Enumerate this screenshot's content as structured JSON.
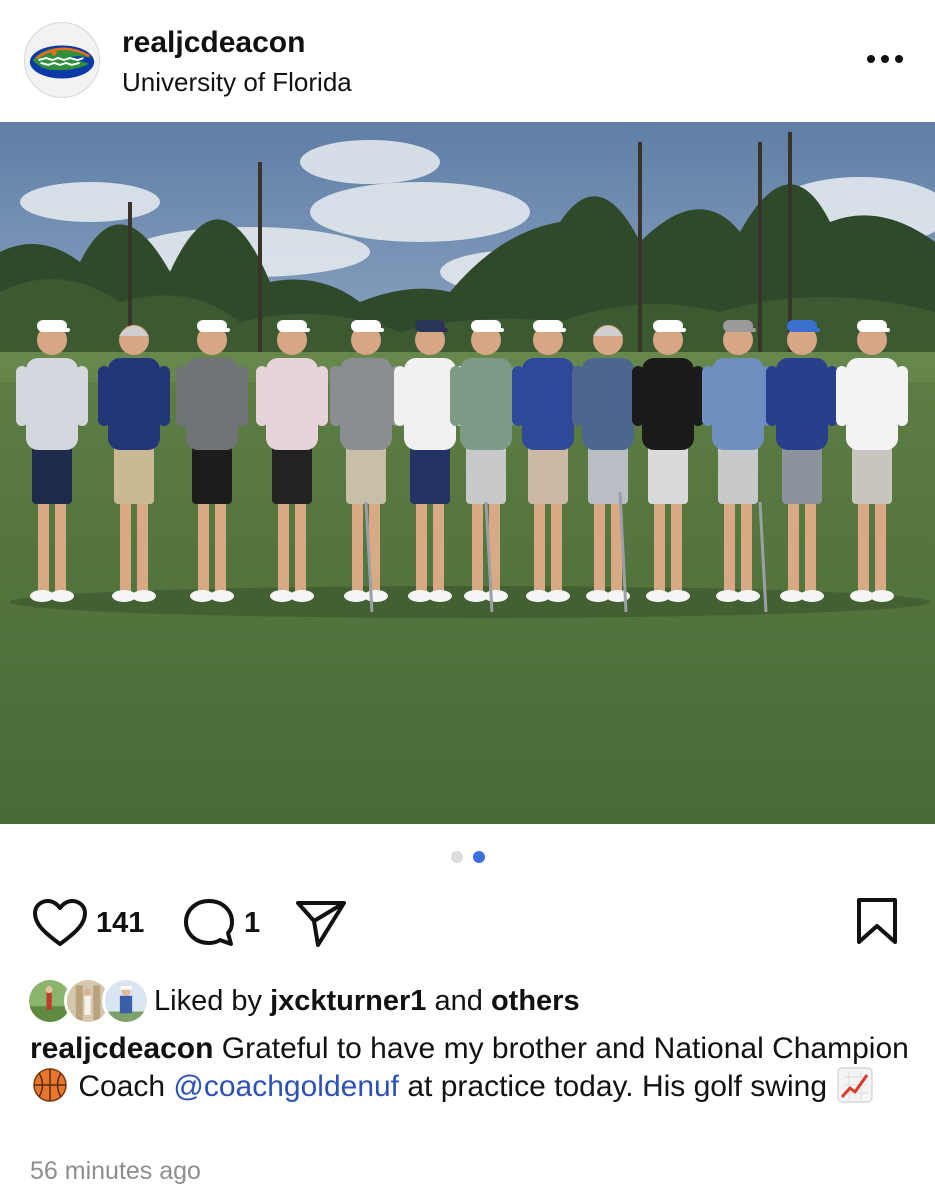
{
  "header": {
    "username": "realjcdeacon",
    "location": "University of Florida",
    "avatar_icon": "gator-logo",
    "more_icon": "more-horizontal-icon"
  },
  "photo": {
    "carousel": {
      "total": 2,
      "active_index": 2
    }
  },
  "actions": {
    "like_icon": "heart-icon",
    "like_count": "141",
    "comment_icon": "comment-icon",
    "comment_count": "1",
    "share_icon": "send-icon",
    "save_icon": "bookmark-icon"
  },
  "likes": {
    "prefix": "Liked by",
    "user": "jxckturner1",
    "middle": "and",
    "suffix": "others"
  },
  "caption": {
    "author": "realjcdeacon",
    "text_1": "Grateful to have my brother and National Champion",
    "emoji_1": "basketball-emoji",
    "text_2": "Coach",
    "mention": "@coachgoldenuf",
    "text_3": "at practice today. His golf swing",
    "emoji_2": "chart-increasing-emoji"
  },
  "timestamp": "56 minutes ago",
  "colors": {
    "accent_blue": "#3c6fe0",
    "mention_blue": "#2c51b8",
    "muted_gray": "#8e8e8e"
  }
}
